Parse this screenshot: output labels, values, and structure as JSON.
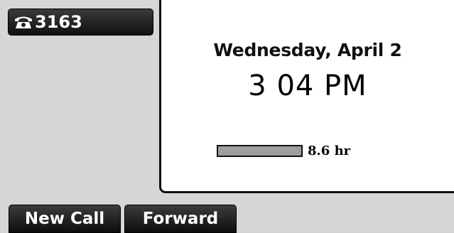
{
  "line_key": {
    "icon": "phone-handset-icon",
    "label": "3163"
  },
  "idle": {
    "date": "Wednesday, April 2",
    "time": "3 04 PM",
    "usage_label": "8.6 hr",
    "usage_fraction": 1.0
  },
  "softkeys": [
    {
      "label": "New Call"
    },
    {
      "label": "Forward"
    }
  ],
  "colors": {
    "background": "#d6d6d6",
    "panel": "#ffffff",
    "key": "#1a1a1a",
    "bar": "#9e9e9e"
  }
}
